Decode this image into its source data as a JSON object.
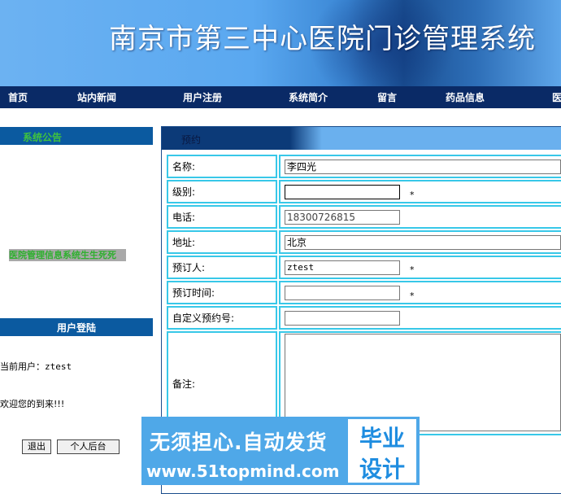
{
  "header": {
    "title": "南京市第三中心医院门诊管理系统"
  },
  "nav": {
    "items": [
      "首页",
      "站内新闻",
      "用户注册",
      "系统简介",
      "留言",
      "药品信息",
      "医"
    ]
  },
  "sidebar": {
    "notice_title": "系统公告",
    "notice_item": "医院管理信息系统生生死死",
    "login_title": "用户登陆",
    "current_user_label": "当前用户：",
    "current_user_value": "ztest",
    "welcome": "欢迎您的到来!!!",
    "logout_label": "退出",
    "admin_label": "个人后台"
  },
  "panel": {
    "title": "预约",
    "fields": [
      {
        "label": "名称:",
        "value": "李四光",
        "required": false
      },
      {
        "label": "级别:",
        "value": "",
        "required": true
      },
      {
        "label": "电话:",
        "value": "18300726815",
        "required": false
      },
      {
        "label": "地址:",
        "value": "北京",
        "required": false
      },
      {
        "label": "预订人:",
        "value": "ztest",
        "required": true
      },
      {
        "label": "预订时间:",
        "value": "",
        "required": true
      },
      {
        "label": "自定义预约号:",
        "value": "",
        "required": false
      },
      {
        "label": "备注:",
        "value": "",
        "required": false
      }
    ],
    "required_mark": "*"
  },
  "watermark": {
    "line1": "无须担心.自动发货",
    "line2": "www.51topmind.com",
    "badge_top": "毕业",
    "badge_bottom": "设计"
  }
}
